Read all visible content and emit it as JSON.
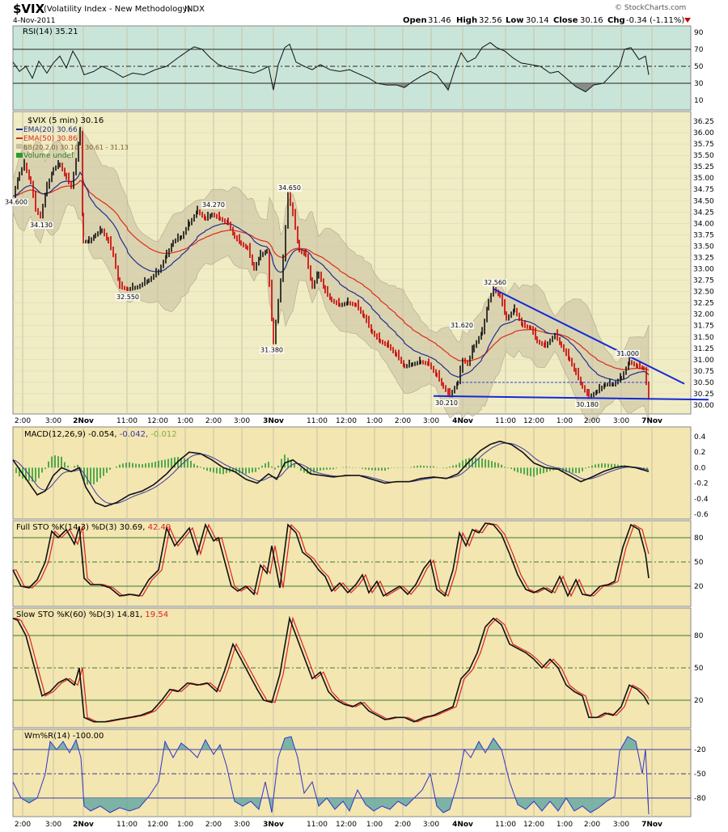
{
  "header": {
    "symbol": "$VIX",
    "name": "(Volatility Index - New Methodology)",
    "exchange": "INDX",
    "date": "4-Nov-2011",
    "copyright": "© StockCharts.com",
    "open_label": "Open",
    "open": "31.46",
    "high_label": "High",
    "high": "32.56",
    "low_label": "Low",
    "low": "30.14",
    "close_label": "Close",
    "close": "30.16",
    "chg_label": "Chg",
    "chg": "-0.34 (-1.11%)"
  },
  "legends": {
    "rsi": "RSI(14) 35.21",
    "price": "$VIX (5 min) 30.16",
    "ema20": "EMA(20) 30.66",
    "ema50": "EMA(50) 30.86",
    "bb": "BB(20,2.0) 30.10 - 30.61 - 31.13",
    "volume": "Volume undef",
    "macd_main": "MACD(12,26,9) -0.054,",
    "macd_signal": "-0.042,",
    "macd_hist": "-0.012",
    "fsto_main": "Full STO %K(14,3) %D(3) 30.69,",
    "fsto_d": "42.49",
    "ssto_main": "Slow STO %K(60) %D(3) 14.81,",
    "ssto_d": "19.54",
    "wr": "Wm%R(14) -100.00"
  },
  "time_axis": [
    "2:00",
    "3:00",
    "2Nov",
    "11:00",
    "12:00",
    "1:00",
    "2:00",
    "3:00",
    "3Nov",
    "11:00",
    "12:00",
    "1:00",
    "2:00",
    "3:00",
    "4Nov",
    "11:00",
    "12:00",
    "1:00",
    "2:00",
    "3:00",
    "7Nov"
  ],
  "axes": {
    "rsi_ticks": [
      "90",
      "70",
      "50",
      "30",
      "10"
    ],
    "price_ticks": [
      "36.25",
      "36.00",
      "35.75",
      "35.50",
      "35.25",
      "35.00",
      "34.75",
      "34.50",
      "34.25",
      "34.00",
      "33.75",
      "33.50",
      "33.25",
      "33.00",
      "32.75",
      "32.50",
      "32.25",
      "32.00",
      "31.75",
      "31.50",
      "31.25",
      "31.00",
      "30.75",
      "30.50",
      "30.25",
      "30.00"
    ],
    "macd_ticks": [
      "0.4",
      "0.2",
      "0.0",
      "-0.2",
      "-0.4",
      "-0.6"
    ],
    "fsto_ticks": [
      "80",
      "50",
      "20"
    ],
    "ssto_ticks": [
      "80",
      "50",
      "20"
    ],
    "wr_ticks": [
      "-20",
      "-50",
      "-80"
    ]
  },
  "colors": {
    "price_bg": "#f0ecc4",
    "ind_bg": "#f3e6b0",
    "rsi_bg": "#c9e5da",
    "ema20": "#1f2e8c",
    "ema50": "#dd2a1a",
    "up": "#111111",
    "down": "#cc0000",
    "trend": "#1428d8",
    "bb_fill": "#c8c0a0",
    "macd_hist": "#2a9a32",
    "sto_d": "#dd2222",
    "wr_fill": "#66a9a3",
    "wr_line": "#3333cc"
  },
  "chart_data": {
    "type": "line",
    "title": "$VIX (Volatility Index - New Methodology) INDX",
    "x": [
      "2:00",
      "3:00",
      "2Nov",
      "11:00",
      "12:00",
      "1:00",
      "2:00",
      "3:00",
      "3Nov",
      "11:00",
      "12:00",
      "1:00",
      "2:00",
      "3:00",
      "4Nov",
      "11:00",
      "12:00",
      "1:00",
      "2:00",
      "3:00",
      "7Nov"
    ],
    "series": [
      {
        "name": "$VIX (5 min)",
        "values": [
          34.6,
          34.9,
          35.4,
          32.7,
          32.7,
          33.6,
          34.1,
          33.3,
          34.4,
          33.2,
          32.2,
          31.8,
          30.8,
          30.7,
          30.4,
          32.3,
          31.7,
          31.2,
          30.25,
          30.6,
          30.16
        ]
      },
      {
        "name": "EMA(20)",
        "values": [
          34.9,
          34.9,
          35.0,
          33.6,
          33.0,
          33.3,
          33.8,
          33.6,
          33.6,
          33.4,
          32.7,
          32.1,
          31.3,
          30.8,
          30.7,
          31.5,
          31.6,
          31.3,
          30.7,
          30.6,
          30.66
        ]
      },
      {
        "name": "EMA(50)",
        "values": [
          35.0,
          35.0,
          35.05,
          34.2,
          33.7,
          33.6,
          33.8,
          33.7,
          33.6,
          33.4,
          33.0,
          32.5,
          31.9,
          31.4,
          31.2,
          31.4,
          31.5,
          31.4,
          31.1,
          30.9,
          30.86
        ]
      }
    ],
    "annotations": [
      "34.600",
      "34.130",
      "32.550",
      "34.270",
      "34.650",
      "31.380",
      "30.210",
      "31.620",
      "32.560",
      "30.180",
      "31.000"
    ],
    "ylim": [
      30.0,
      36.3
    ]
  }
}
